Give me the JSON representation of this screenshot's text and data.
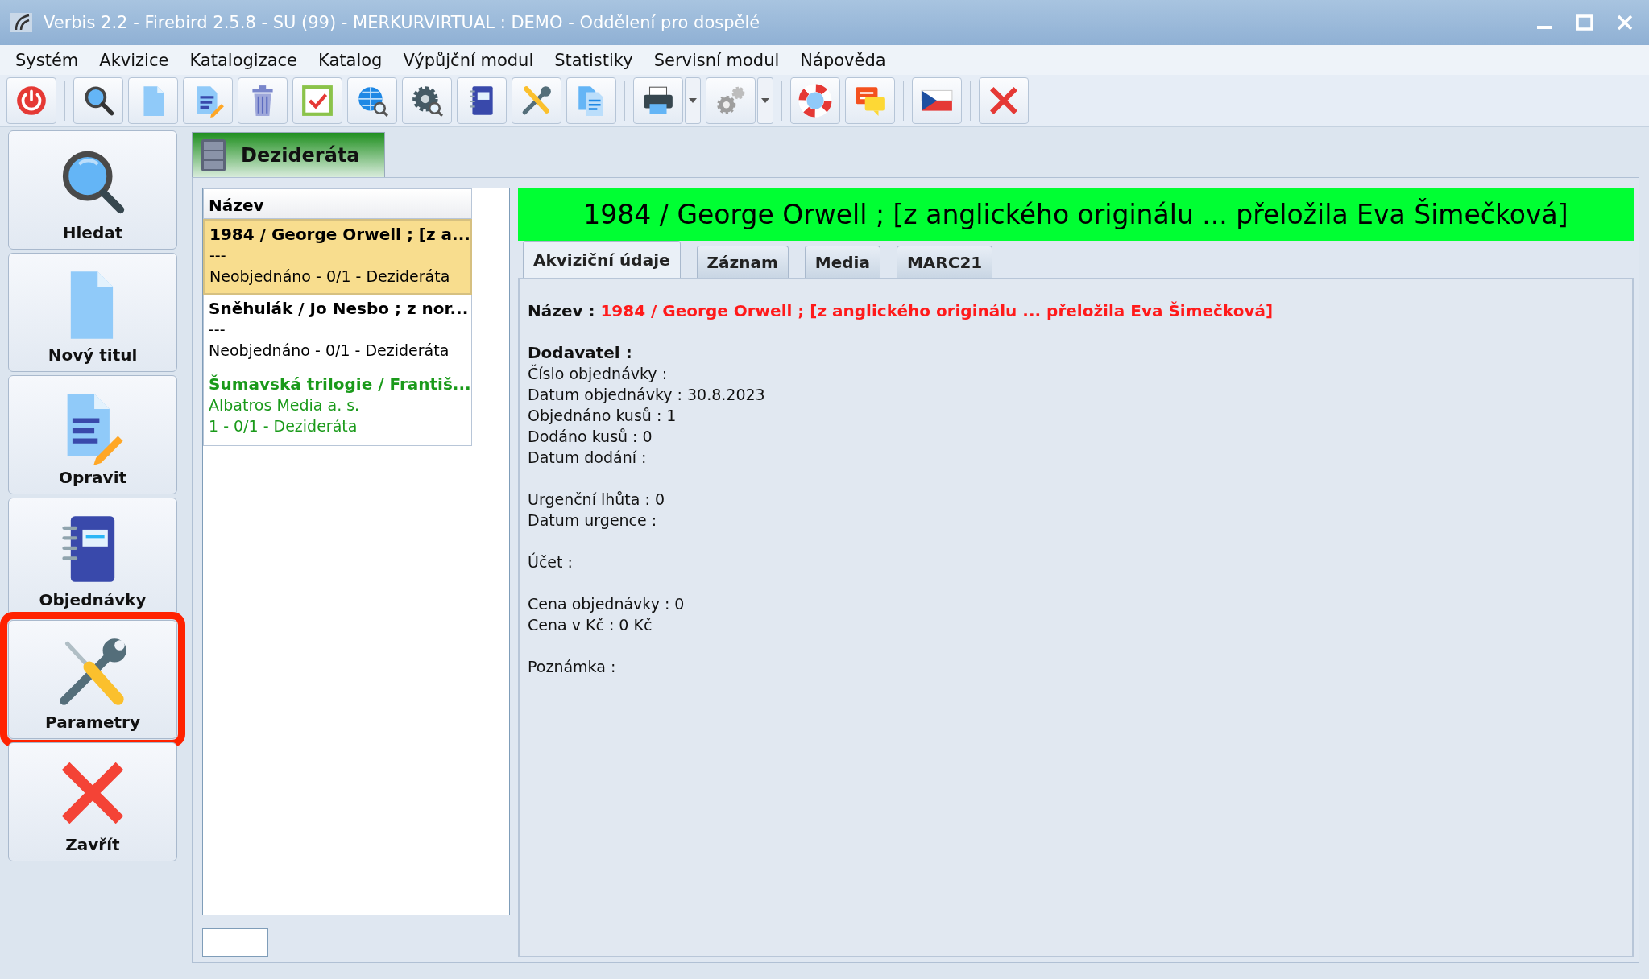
{
  "window": {
    "title": "Verbis 2.2 - Firebird 2.5.8 - SU (99) - MERKURVIRTUAL : DEMO - Oddělení pro dospělé"
  },
  "menu": [
    "Systém",
    "Akvizice",
    "Katalogizace",
    "Katalog",
    "Výpůjční modul",
    "Statistiky",
    "Servisní modul",
    "Nápověda"
  ],
  "sidebar": {
    "items": [
      {
        "label": "Hledat",
        "highlighted": false
      },
      {
        "label": "Nový titul",
        "highlighted": false
      },
      {
        "label": "Opravit",
        "highlighted": false
      },
      {
        "label": "Objednávky",
        "highlighted": false
      },
      {
        "label": "Parametry",
        "highlighted": true
      },
      {
        "label": "Zavřít",
        "highlighted": false
      }
    ]
  },
  "module_tab": {
    "label": "Dezideráta"
  },
  "list": {
    "header": "Název",
    "items": [
      {
        "title": "1984 / George Orwell ; [z a...",
        "line_2": "---",
        "line_3": "Neobjednáno - 0/1 - Dezideráta",
        "selected": true,
        "color": "#000000"
      },
      {
        "title": "Sněhulák / Jo Nesbo ; z nor...",
        "line_2": "---",
        "line_3": "Neobjednáno - 0/1 - Dezideráta",
        "selected": false,
        "color": "#000000"
      },
      {
        "title": "Šumavská trilogie / Františ...",
        "line_2": "Albatros Media a. s.",
        "line_3": "1 - 0/1 - Dezideráta",
        "selected": false,
        "color": "#1a9a1a"
      }
    ]
  },
  "detail": {
    "header": "1984 / George Orwell ; [z anglického originálu ... přeložila Eva Šimečková]",
    "tabs": [
      {
        "label": "Akviziční údaje",
        "selected": true
      },
      {
        "label": "Záznam",
        "selected": false
      },
      {
        "label": "Media",
        "selected": false
      },
      {
        "label": "MARC21",
        "selected": false
      }
    ],
    "title_label": "Název :",
    "title_value": "1984 / George Orwell ; [z anglického originálu ... přeložila Eva Šimečková]",
    "supplier_heading": "Dodavatel :",
    "groups": [
      [
        "Číslo objednávky :",
        "Datum objednávky : 30.8.2023",
        "Objednáno kusů : 1",
        "Dodáno kusů : 0",
        "Datum dodání :"
      ],
      [
        "Urgenční lhůta : 0",
        "Datum urgence :"
      ],
      [
        "Účet :"
      ],
      [
        "Cena objednávky : 0",
        "Cena v Kč : 0 Kč"
      ],
      [
        "Poznámka :"
      ]
    ]
  }
}
